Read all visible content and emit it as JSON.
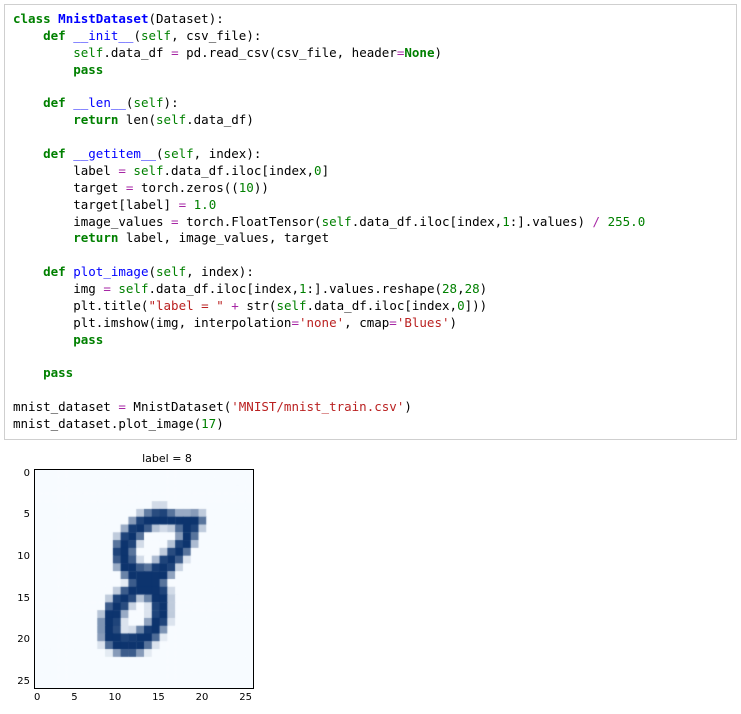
{
  "code": {
    "tokens": [
      [
        [
          "kw",
          "class"
        ],
        [
          "",
          ""
        ],
        [
          "",
          " "
        ],
        [
          "cls",
          "MnistDataset"
        ],
        [
          "",
          "(Dataset):"
        ]
      ],
      [
        [
          "",
          "    "
        ],
        [
          "kw",
          "def"
        ],
        [
          "",
          " "
        ],
        [
          "fn",
          "__init__"
        ],
        [
          "",
          "("
        ],
        [
          "self",
          "self"
        ],
        [
          "",
          ", csv_file):"
        ]
      ],
      [
        [
          "",
          "        "
        ],
        [
          "self",
          "self"
        ],
        [
          "",
          ".data_df "
        ],
        [
          "op",
          "="
        ],
        [
          "",
          " pd.read_csv(csv_file, header"
        ],
        [
          "op",
          "="
        ],
        [
          "const",
          "None"
        ],
        [
          "",
          ")"
        ]
      ],
      [
        [
          "",
          "        "
        ],
        [
          "kw",
          "pass"
        ]
      ],
      [
        [
          "",
          ""
        ]
      ],
      [
        [
          "",
          "    "
        ],
        [
          "kw",
          "def"
        ],
        [
          "",
          " "
        ],
        [
          "fn",
          "__len__"
        ],
        [
          "",
          "("
        ],
        [
          "self",
          "self"
        ],
        [
          "",
          "):"
        ]
      ],
      [
        [
          "",
          "        "
        ],
        [
          "kw",
          "return"
        ],
        [
          "",
          " "
        ],
        [
          "",
          "len"
        ],
        [
          "",
          "("
        ],
        [
          "self",
          "self"
        ],
        [
          "",
          ".data_df)"
        ]
      ],
      [
        [
          "",
          ""
        ]
      ],
      [
        [
          "",
          "    "
        ],
        [
          "kw",
          "def"
        ],
        [
          "",
          " "
        ],
        [
          "fn",
          "__getitem__"
        ],
        [
          "",
          "("
        ],
        [
          "self",
          "self"
        ],
        [
          "",
          ", index):"
        ]
      ],
      [
        [
          "",
          "        label "
        ],
        [
          "op",
          "="
        ],
        [
          "",
          " "
        ],
        [
          "self",
          "self"
        ],
        [
          "",
          ".data_df.iloc[index,"
        ],
        [
          "num",
          "0"
        ],
        [
          "",
          "]"
        ]
      ],
      [
        [
          "",
          "        target "
        ],
        [
          "op",
          "="
        ],
        [
          "",
          " torch.zeros(("
        ],
        [
          "num",
          "10"
        ],
        [
          "",
          "))"
        ]
      ],
      [
        [
          "",
          "        target[label] "
        ],
        [
          "op",
          "="
        ],
        [
          "",
          " "
        ],
        [
          "num",
          "1.0"
        ]
      ],
      [
        [
          "",
          "        image_values "
        ],
        [
          "op",
          "="
        ],
        [
          "",
          " torch.FloatTensor("
        ],
        [
          "self",
          "self"
        ],
        [
          "",
          ".data_df.iloc[index,"
        ],
        [
          "num",
          "1"
        ],
        [
          "",
          ":].values) "
        ],
        [
          "op",
          "/"
        ],
        [
          "",
          " "
        ],
        [
          "num",
          "255.0"
        ]
      ],
      [
        [
          "",
          "        "
        ],
        [
          "kw",
          "return"
        ],
        [
          "",
          " label, image_values, target"
        ]
      ],
      [
        [
          "",
          ""
        ]
      ],
      [
        [
          "",
          "    "
        ],
        [
          "kw",
          "def"
        ],
        [
          "",
          " "
        ],
        [
          "fn",
          "plot_image"
        ],
        [
          "",
          "("
        ],
        [
          "self",
          "self"
        ],
        [
          "",
          ", index):"
        ]
      ],
      [
        [
          "",
          "        img "
        ],
        [
          "op",
          "="
        ],
        [
          "",
          " "
        ],
        [
          "self",
          "self"
        ],
        [
          "",
          ".data_df.iloc[index,"
        ],
        [
          "num",
          "1"
        ],
        [
          "",
          ":].values.reshape("
        ],
        [
          "num",
          "28"
        ],
        [
          "",
          ","
        ],
        [
          "num",
          "28"
        ],
        [
          "",
          ")"
        ]
      ],
      [
        [
          "",
          "        plt.title("
        ],
        [
          "str",
          "\"label = \""
        ],
        [
          "",
          " "
        ],
        [
          "op",
          "+"
        ],
        [
          "",
          " str("
        ],
        [
          "self",
          "self"
        ],
        [
          "",
          ".data_df.iloc[index,"
        ],
        [
          "num",
          "0"
        ],
        [
          "",
          "]))"
        ]
      ],
      [
        [
          "",
          "        plt.imshow(img, interpolation"
        ],
        [
          "op",
          "="
        ],
        [
          "str",
          "'none'"
        ],
        [
          "",
          ", cmap"
        ],
        [
          "op",
          "="
        ],
        [
          "str",
          "'Blues'"
        ],
        [
          "",
          ")"
        ]
      ],
      [
        [
          "",
          "        "
        ],
        [
          "kw",
          "pass"
        ]
      ],
      [
        [
          "",
          ""
        ]
      ],
      [
        [
          "",
          "    "
        ],
        [
          "kw",
          "pass"
        ]
      ],
      [
        [
          "",
          ""
        ]
      ],
      [
        [
          "",
          "mnist_dataset "
        ],
        [
          "op",
          "="
        ],
        [
          "",
          " MnistDataset("
        ],
        [
          "str",
          "'MNIST/mnist_train.csv'"
        ],
        [
          "",
          ")"
        ]
      ],
      [
        [
          "",
          "mnist_dataset.plot_image("
        ],
        [
          "num",
          "17"
        ],
        [
          "",
          ")"
        ]
      ]
    ]
  },
  "chart_data": {
    "type": "heatmap",
    "title": "label = 8",
    "xlabel": "",
    "ylabel": "",
    "xticks": [
      0,
      5,
      10,
      15,
      20,
      25
    ],
    "yticks": [
      0,
      5,
      10,
      15,
      20,
      25
    ],
    "xlim": [
      0,
      27
    ],
    "ylim": [
      0,
      27
    ],
    "cmap": "Blues",
    "grid_size": 28,
    "values": [
      [
        0,
        0,
        0,
        0,
        0,
        0,
        0,
        0,
        0,
        0,
        0,
        0,
        0,
        0,
        0,
        0,
        0,
        0,
        0,
        0,
        0,
        0,
        0,
        0,
        0,
        0,
        0,
        0
      ],
      [
        0,
        0,
        0,
        0,
        0,
        0,
        0,
        0,
        0,
        0,
        0,
        0,
        0,
        0,
        0,
        0,
        0,
        0,
        0,
        0,
        0,
        0,
        0,
        0,
        0,
        0,
        0,
        0
      ],
      [
        0,
        0,
        0,
        0,
        0,
        0,
        0,
        0,
        0,
        0,
        0,
        0,
        0,
        0,
        0,
        0,
        0,
        0,
        0,
        0,
        0,
        0,
        0,
        0,
        0,
        0,
        0,
        0
      ],
      [
        0,
        0,
        0,
        0,
        0,
        0,
        0,
        0,
        0,
        0,
        0,
        0,
        0,
        0,
        0,
        0,
        0,
        0,
        0,
        0,
        0,
        0,
        0,
        0,
        0,
        0,
        0,
        0
      ],
      [
        0,
        0,
        0,
        0,
        0,
        0,
        0,
        0,
        0,
        0,
        0,
        0,
        0,
        0,
        0,
        40,
        40,
        0,
        0,
        0,
        0,
        0,
        0,
        0,
        0,
        0,
        0,
        0
      ],
      [
        0,
        0,
        0,
        0,
        0,
        0,
        0,
        0,
        0,
        0,
        0,
        0,
        0,
        60,
        160,
        220,
        230,
        170,
        100,
        100,
        120,
        60,
        0,
        0,
        0,
        0,
        0,
        0
      ],
      [
        0,
        0,
        0,
        0,
        0,
        0,
        0,
        0,
        0,
        0,
        0,
        0,
        120,
        230,
        250,
        250,
        250,
        250,
        250,
        250,
        250,
        170,
        0,
        0,
        0,
        0,
        0,
        0
      ],
      [
        0,
        0,
        0,
        0,
        0,
        0,
        0,
        0,
        0,
        0,
        0,
        100,
        240,
        250,
        200,
        70,
        40,
        60,
        180,
        250,
        230,
        60,
        0,
        0,
        0,
        0,
        0,
        0
      ],
      [
        0,
        0,
        0,
        0,
        0,
        0,
        0,
        0,
        0,
        0,
        60,
        230,
        250,
        170,
        0,
        0,
        0,
        0,
        120,
        250,
        170,
        0,
        0,
        0,
        0,
        0,
        0,
        0
      ],
      [
        0,
        0,
        0,
        0,
        0,
        0,
        0,
        0,
        0,
        0,
        170,
        250,
        230,
        40,
        0,
        0,
        0,
        70,
        230,
        250,
        80,
        0,
        0,
        0,
        0,
        0,
        0,
        0
      ],
      [
        0,
        0,
        0,
        0,
        0,
        0,
        0,
        0,
        0,
        0,
        230,
        250,
        170,
        0,
        0,
        0,
        60,
        220,
        250,
        170,
        0,
        0,
        0,
        0,
        0,
        0,
        0,
        0
      ],
      [
        0,
        0,
        0,
        0,
        0,
        0,
        0,
        0,
        0,
        0,
        200,
        250,
        200,
        40,
        0,
        80,
        230,
        250,
        200,
        30,
        0,
        0,
        0,
        0,
        0,
        0,
        0,
        0
      ],
      [
        0,
        0,
        0,
        0,
        0,
        0,
        0,
        0,
        0,
        0,
        100,
        250,
        250,
        200,
        170,
        240,
        250,
        230,
        50,
        0,
        0,
        0,
        0,
        0,
        0,
        0,
        0,
        0
      ],
      [
        0,
        0,
        0,
        0,
        0,
        0,
        0,
        0,
        0,
        0,
        0,
        150,
        250,
        250,
        250,
        250,
        250,
        110,
        0,
        0,
        0,
        0,
        0,
        0,
        0,
        0,
        0,
        0
      ],
      [
        0,
        0,
        0,
        0,
        0,
        0,
        0,
        0,
        0,
        0,
        0,
        20,
        200,
        250,
        250,
        250,
        170,
        0,
        0,
        0,
        0,
        0,
        0,
        0,
        0,
        0,
        0,
        0
      ],
      [
        0,
        0,
        0,
        0,
        0,
        0,
        0,
        0,
        0,
        0,
        60,
        200,
        250,
        250,
        250,
        250,
        230,
        40,
        0,
        0,
        0,
        0,
        0,
        0,
        0,
        0,
        0,
        0
      ],
      [
        0,
        0,
        0,
        0,
        0,
        0,
        0,
        0,
        0,
        60,
        230,
        250,
        220,
        70,
        150,
        250,
        250,
        60,
        0,
        0,
        0,
        0,
        0,
        0,
        0,
        0,
        0,
        0
      ],
      [
        0,
        0,
        0,
        0,
        0,
        0,
        0,
        0,
        0,
        200,
        250,
        220,
        50,
        0,
        30,
        230,
        250,
        60,
        0,
        0,
        0,
        0,
        0,
        0,
        0,
        0,
        0,
        0
      ],
      [
        0,
        0,
        0,
        0,
        0,
        0,
        0,
        0,
        70,
        250,
        250,
        100,
        0,
        0,
        30,
        230,
        250,
        60,
        0,
        0,
        0,
        0,
        0,
        0,
        0,
        0,
        0,
        0
      ],
      [
        0,
        0,
        0,
        0,
        0,
        0,
        0,
        0,
        130,
        250,
        230,
        30,
        0,
        0,
        110,
        250,
        230,
        30,
        0,
        0,
        0,
        0,
        0,
        0,
        0,
        0,
        0,
        0
      ],
      [
        0,
        0,
        0,
        0,
        0,
        0,
        0,
        0,
        130,
        250,
        220,
        30,
        40,
        150,
        240,
        250,
        130,
        0,
        0,
        0,
        0,
        0,
        0,
        0,
        0,
        0,
        0,
        0
      ],
      [
        0,
        0,
        0,
        0,
        0,
        0,
        0,
        0,
        120,
        250,
        250,
        230,
        240,
        250,
        250,
        180,
        20,
        0,
        0,
        0,
        0,
        0,
        0,
        0,
        0,
        0,
        0,
        0
      ],
      [
        0,
        0,
        0,
        0,
        0,
        0,
        0,
        0,
        30,
        180,
        250,
        250,
        250,
        250,
        170,
        30,
        0,
        0,
        0,
        0,
        0,
        0,
        0,
        0,
        0,
        0,
        0,
        0
      ],
      [
        0,
        0,
        0,
        0,
        0,
        0,
        0,
        0,
        0,
        20,
        120,
        200,
        200,
        120,
        20,
        0,
        0,
        0,
        0,
        0,
        0,
        0,
        0,
        0,
        0,
        0,
        0,
        0
      ],
      [
        0,
        0,
        0,
        0,
        0,
        0,
        0,
        0,
        0,
        0,
        0,
        0,
        0,
        0,
        0,
        0,
        0,
        0,
        0,
        0,
        0,
        0,
        0,
        0,
        0,
        0,
        0,
        0
      ],
      [
        0,
        0,
        0,
        0,
        0,
        0,
        0,
        0,
        0,
        0,
        0,
        0,
        0,
        0,
        0,
        0,
        0,
        0,
        0,
        0,
        0,
        0,
        0,
        0,
        0,
        0,
        0,
        0
      ],
      [
        0,
        0,
        0,
        0,
        0,
        0,
        0,
        0,
        0,
        0,
        0,
        0,
        0,
        0,
        0,
        0,
        0,
        0,
        0,
        0,
        0,
        0,
        0,
        0,
        0,
        0,
        0,
        0
      ],
      [
        0,
        0,
        0,
        0,
        0,
        0,
        0,
        0,
        0,
        0,
        0,
        0,
        0,
        0,
        0,
        0,
        0,
        0,
        0,
        0,
        0,
        0,
        0,
        0,
        0,
        0,
        0,
        0
      ]
    ]
  }
}
